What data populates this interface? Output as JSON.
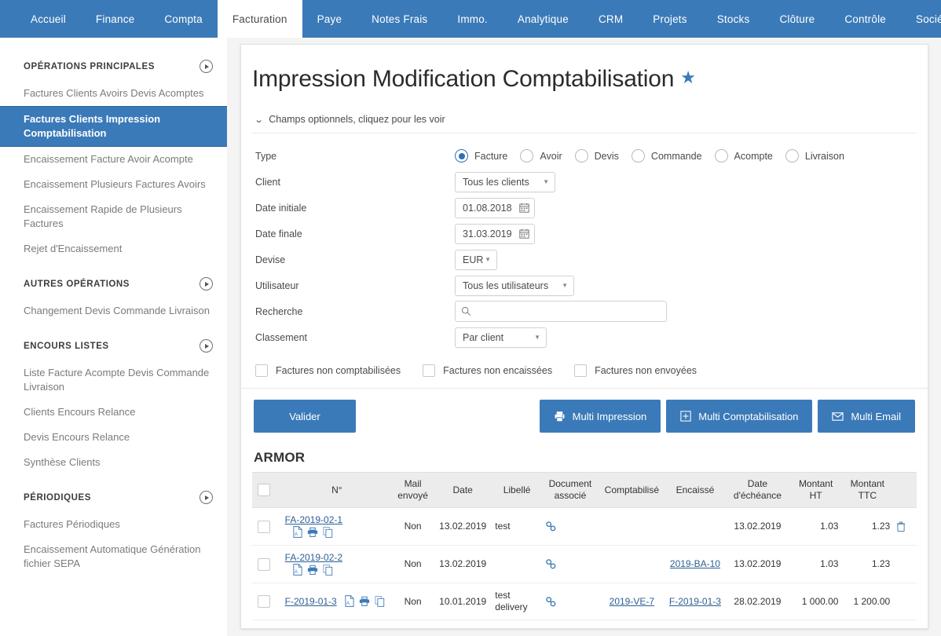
{
  "topnav": {
    "items": [
      {
        "label": "Accueil",
        "active": false
      },
      {
        "label": "Finance",
        "active": false
      },
      {
        "label": "Compta",
        "active": false
      },
      {
        "label": "Facturation",
        "active": true
      },
      {
        "label": "Paye",
        "active": false
      },
      {
        "label": "Notes Frais",
        "active": false
      },
      {
        "label": "Immo.",
        "active": false
      },
      {
        "label": "Analytique",
        "active": false
      },
      {
        "label": "CRM",
        "active": false
      },
      {
        "label": "Projets",
        "active": false
      },
      {
        "label": "Stocks",
        "active": false
      },
      {
        "label": "Clôture",
        "active": false
      },
      {
        "label": "Contrôle",
        "active": false
      },
      {
        "label": "Société",
        "active": false
      }
    ]
  },
  "sidebar": {
    "sections": [
      {
        "title": "OPÉRATIONS PRINCIPALES",
        "items": [
          {
            "label": "Factures Clients Avoirs Devis Acomptes",
            "active": false
          },
          {
            "label": "Factures Clients Impression Comptabilisation",
            "active": true
          },
          {
            "label": "Encaissement Facture Avoir Acompte",
            "active": false
          },
          {
            "label": "Encaissement Plusieurs Factures Avoirs",
            "active": false
          },
          {
            "label": "Encaissement Rapide de Plusieurs Factures",
            "active": false
          },
          {
            "label": "Rejet d'Encaissement",
            "active": false
          }
        ]
      },
      {
        "title": "AUTRES OPÉRATIONS",
        "items": [
          {
            "label": "Changement Devis Commande Livraison",
            "active": false
          }
        ]
      },
      {
        "title": "ENCOURS LISTES",
        "items": [
          {
            "label": "Liste Facture Acompte Devis Commande Livraison",
            "active": false
          },
          {
            "label": "Clients Encours Relance",
            "active": false
          },
          {
            "label": "Devis Encours Relance",
            "active": false
          },
          {
            "label": "Synthèse Clients",
            "active": false
          }
        ]
      },
      {
        "title": "PÉRIODIQUES",
        "items": [
          {
            "label": "Factures Périodiques",
            "active": false
          },
          {
            "label": "Encaissement Automatique Génération fichier SEPA",
            "active": false
          }
        ]
      }
    ]
  },
  "page": {
    "title": "Impression Modification Comptabilisation",
    "optional_fields_toggle": "Champs optionnels, cliquez pour les voir"
  },
  "form": {
    "type": {
      "label": "Type",
      "options": [
        {
          "label": "Facture",
          "checked": true
        },
        {
          "label": "Avoir",
          "checked": false
        },
        {
          "label": "Devis",
          "checked": false
        },
        {
          "label": "Commande",
          "checked": false
        },
        {
          "label": "Acompte",
          "checked": false
        },
        {
          "label": "Livraison",
          "checked": false
        }
      ]
    },
    "client": {
      "label": "Client",
      "value": "Tous les clients"
    },
    "date_initiale": {
      "label": "Date initiale",
      "value": "01.08.2018"
    },
    "date_finale": {
      "label": "Date finale",
      "value": "31.03.2019"
    },
    "devise": {
      "label": "Devise",
      "value": "EUR"
    },
    "utilisateur": {
      "label": "Utilisateur",
      "value": "Tous les utilisateurs"
    },
    "recherche": {
      "label": "Recherche",
      "value": "",
      "placeholder": ""
    },
    "classement": {
      "label": "Classement",
      "value": "Par client"
    },
    "checkboxes": [
      {
        "label": "Factures non comptabilisées",
        "checked": false
      },
      {
        "label": "Factures non encaissées",
        "checked": false
      },
      {
        "label": "Factures non envoyées",
        "checked": false
      }
    ]
  },
  "buttons": {
    "valider": "Valider",
    "multi_impression": "Multi Impression",
    "multi_comptabilisation": "Multi Comptabilisation",
    "multi_email": "Multi Email"
  },
  "table": {
    "group_title": "ARMOR",
    "headers": {
      "num": "N°",
      "mail_envoye": "Mail envoyé",
      "date": "Date",
      "libelle": "Libellé",
      "document_associe": "Document associé",
      "comptabilise": "Comptabilisé",
      "encaisse": "Encaissé",
      "date_echeance": "Date d'échéance",
      "montant_ht": "Montant HT",
      "montant_ttc": "Montant TTC"
    },
    "rows": [
      {
        "num": "FA-2019-02-1",
        "mail_envoye": "Non",
        "date": "13.02.2019",
        "libelle": "test",
        "comptabilise": "",
        "encaisse": "",
        "date_echeance": "13.02.2019",
        "montant_ht": "1.03",
        "montant_ttc": "1.23",
        "has_delete": true
      },
      {
        "num": "FA-2019-02-2",
        "mail_envoye": "Non",
        "date": "13.02.2019",
        "libelle": "",
        "comptabilise": "",
        "encaisse": "2019-BA-10",
        "date_echeance": "13.02.2019",
        "montant_ht": "1.03",
        "montant_ttc": "1.23",
        "has_delete": false
      },
      {
        "num": "F-2019-01-3",
        "mail_envoye": "Non",
        "date": "10.01.2019",
        "libelle": "test delivery",
        "comptabilise": "2019-VE-7",
        "encaisse": "F-2019-01-3",
        "date_echeance": "28.02.2019",
        "montant_ht": "1 000.00",
        "montant_ttc": "1 200.00",
        "has_delete": false
      }
    ]
  },
  "colors": {
    "brand_blue": "#3b7ab8",
    "link_blue": "#2d5f96",
    "header_grey": "#ececec"
  }
}
